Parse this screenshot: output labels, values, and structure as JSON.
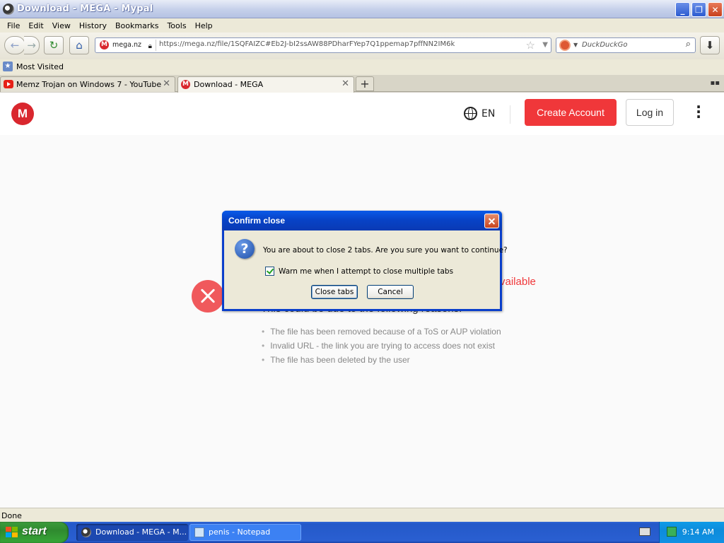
{
  "window": {
    "title": "Download - MEGA - Mypal"
  },
  "menu": [
    "File",
    "Edit",
    "View",
    "History",
    "Bookmarks",
    "Tools",
    "Help"
  ],
  "nav": {
    "identity": "mega.nz",
    "url": "https://mega.nz/file/1SQFAIZC#Eb2J-bI2ssAW88PDharFYep7Q1ppemap7pffNN2IM6k",
    "search_placeholder": "DuckDuckGo"
  },
  "bookmarks": {
    "most_visited": "Most Visited"
  },
  "tabs": [
    {
      "label": "Memz Trojan on Windows 7 - YouTube",
      "favicon": "youtube-icon",
      "active": false
    },
    {
      "label": "Download - MEGA",
      "favicon": "mega-icon",
      "active": true
    }
  ],
  "page": {
    "logo": "M",
    "lang": "EN",
    "create_account": "Create Account",
    "login": "Log in",
    "unavailable_fragment": "vailable",
    "reasons_head": "This could be due to the following reasons:",
    "reasons": [
      "The file has been removed because of a ToS or AUP violation",
      "Invalid URL - the link you are trying to access does not exist",
      "The file has been deleted by the user"
    ]
  },
  "dialog": {
    "title": "Confirm close",
    "message": "You are about to close 2 tabs. Are you sure you want to continue?",
    "checkbox_label": "Warn me when I attempt to close multiple tabs",
    "checkbox_checked": true,
    "close_tabs": "Close tabs",
    "cancel": "Cancel"
  },
  "status": {
    "text": "Done"
  },
  "taskbar": {
    "start": "start",
    "tasks": [
      {
        "label": "Download - MEGA - M...",
        "active": true
      },
      {
        "label": "penis - Notepad",
        "active": false
      }
    ],
    "clock": "9:14 AM"
  },
  "colors": {
    "mega_red": "#d9272e",
    "create_btn": "#f0373a",
    "xp_blue": "#0a3fcb"
  }
}
